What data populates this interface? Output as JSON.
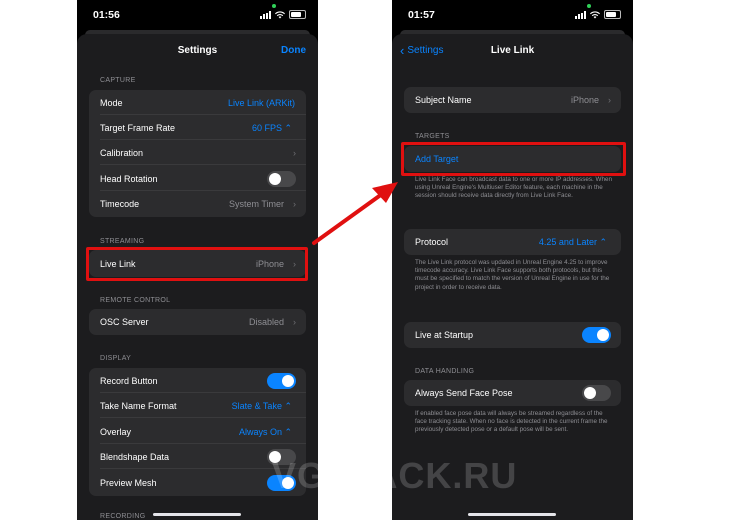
{
  "left": {
    "time": "01:56",
    "title": "Settings",
    "done_label": "Done",
    "sections": {
      "capture": "CAPTURE",
      "streaming": "STREAMING",
      "remote_control": "REMOTE CONTROL",
      "display": "DISPLAY",
      "recording": "RECORDING"
    },
    "capture_rows": [
      {
        "label": "Mode",
        "value": "Live Link (ARKit)"
      },
      {
        "label": "Target Frame Rate",
        "value": "60 FPS ⌃"
      },
      {
        "label": "Calibration",
        "value": ""
      },
      {
        "label": "Head Rotation",
        "value": ""
      },
      {
        "label": "Timecode",
        "value": "System Timer"
      }
    ],
    "streaming_rows": [
      {
        "label": "Live Link",
        "value": "iPhone"
      }
    ],
    "remote_rows": [
      {
        "label": "OSC Server",
        "value": "Disabled"
      }
    ],
    "display_rows": [
      {
        "label": "Record Button",
        "value": ""
      },
      {
        "label": "Take Name Format",
        "value": "Slate & Take ⌃"
      },
      {
        "label": "Overlay",
        "value": "Always On ⌃"
      },
      {
        "label": "Blendshape Data",
        "value": ""
      },
      {
        "label": "Preview Mesh",
        "value": ""
      }
    ]
  },
  "right": {
    "time": "01:57",
    "title": "Live Link",
    "back_label": "Settings",
    "subject": {
      "label": "Subject Name",
      "value": "iPhone"
    },
    "targets_header": "TARGETS",
    "add_target": "Add Target",
    "targets_note": "Live Link Face can broadcast data to one or more IP addresses. When using Unreal Engine's Multiuser Editor feature, each machine in the session should receive data directly from Live Link Face.",
    "protocol": {
      "label": "Protocol",
      "value": "4.25 and Later ⌃"
    },
    "protocol_note": "The Live Link protocol was updated in Unreal Engine 4.25 to improve timecode accuracy.  Live Link Face supports both protocols, but this must be specified to match the version of Unreal Engine in use for the project in order to receive data.",
    "startup": {
      "label": "Live at Startup"
    },
    "data_handling_header": "DATA HANDLING",
    "face_pose": {
      "label": "Always Send Face Pose"
    },
    "face_pose_note": "If enabled face pose data will always be streamed regardless of the face tracking state. When no face is detected in the current frame the previously detected pose or a default pose will be sent."
  },
  "watermark": "VGTPACK.RU",
  "colors": {
    "accent": "#0a84ff",
    "highlight": "#e01010",
    "toggle_on": "#0a84ff"
  },
  "toggles": {
    "head_rotation": false,
    "record_button": true,
    "blendshape_data": false,
    "preview_mesh": true,
    "live_at_startup": true,
    "always_send_face_pose": false
  }
}
